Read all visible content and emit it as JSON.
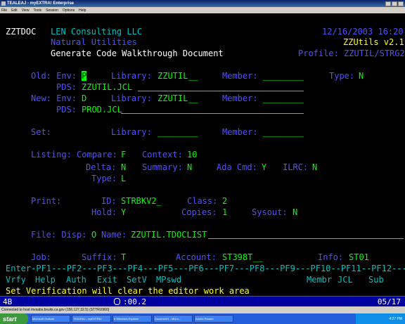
{
  "window": {
    "title": "TEALEAJ - myEXTRA! Enterprise",
    "menu": [
      "File",
      "Edit",
      "View",
      "Tools",
      "Session",
      "Options",
      "Help"
    ]
  },
  "header": {
    "program": "ZZTDOC",
    "company": "LEN Consulting LLC",
    "date": "12/16/2003 16:20",
    "module": "Natural Utilities",
    "version": "ZZUtils v2.1",
    "title": "Generate Code Walkthrough Document",
    "profile": "Profile: ZZUTIL/STRG2"
  },
  "old": {
    "env_label": "Old: Env:",
    "env_value": "P",
    "library_label": "Library:",
    "library_value": "ZZUTIL__",
    "member_label": "Member:",
    "member_value": "________",
    "type_label": "Type:",
    "type_value": "N",
    "pds_label": "PDS:",
    "pds_value": "ZZUTIL.JCL"
  },
  "new": {
    "env_label": "New: Env:",
    "env_value": "D",
    "library_label": "Library:",
    "library_value": "ZZUTIL__",
    "member_label": "Member:",
    "member_value": "________",
    "pds_label": "PDS:",
    "pds_value": "PROD.JCL"
  },
  "set": {
    "set_label": "Set:",
    "library_label": "Library:",
    "library_value": "________",
    "member_label": "Member:",
    "member_value": "________"
  },
  "listing": {
    "compare_label": "Listing: Compare:",
    "compare_value": "F",
    "context_label": "Context:",
    "context_value": "10",
    "delta_label": "Delta:",
    "delta_value": "N",
    "summary_label": "Summary:",
    "summary_value": "N",
    "adacmd_label": "Ada Cmd:",
    "adacmd_value": "Y",
    "ilrc_label": "ILRC:",
    "ilrc_value": "N",
    "type_label": "Type:",
    "type_value": "L"
  },
  "print": {
    "print_label": "Print:",
    "id_label": "ID:",
    "id_value": "STRBKV2_",
    "class_label": "Class:",
    "class_value": "2",
    "hold_label": "Hold:",
    "hold_value": "Y",
    "copies_label": "Copies:",
    "copies_value": "1",
    "sysout_label": "Sysout:",
    "sysout_value": "N"
  },
  "file": {
    "label": "File: Disp:",
    "disp_value": "O",
    "name_label": "Name:",
    "name_value": "ZZUTIL.TDOCLIST"
  },
  "job": {
    "job_label": "Job:",
    "suffix_label": "Suffix:",
    "suffix_value": "T",
    "account_label": "Account:",
    "account_value": "ST398T__",
    "info_label": "Info:",
    "info_value": "ST01"
  },
  "pfkeys": {
    "line": "Enter-PF1---PF2---PF3---PF4---PF5---PF6---PF7---PF8---PF9---PF10--PF11--PF12---",
    "labels": [
      "Vrfy",
      "Help",
      "Auth",
      "Exit",
      "SetV",
      "MPswd",
      "Membr",
      "JCL",
      "Sub"
    ]
  },
  "message": "Set Verification will clear the editor work area",
  "status": {
    "left": "4B",
    "mid": ":00.2",
    "right": "05/17"
  },
  "connection": "Connected to host mvsabs.bsuits.ca.gov (156.127.32.5) (STTRU960)",
  "taskbar": {
    "start": "start",
    "tasks": [
      "Microsoft Outlook",
      "TEALEAJ - myEXTRA!",
      "8 Windows Explorer",
      "Document1 - Micro...",
      "Adobe Reader"
    ],
    "clock": "4:27 PM"
  },
  "colors": {
    "screen_bg": "#000000",
    "label": "#00c0c0",
    "field": "#00ff00",
    "heading": "#5050ff",
    "accent": "#ffff00"
  }
}
